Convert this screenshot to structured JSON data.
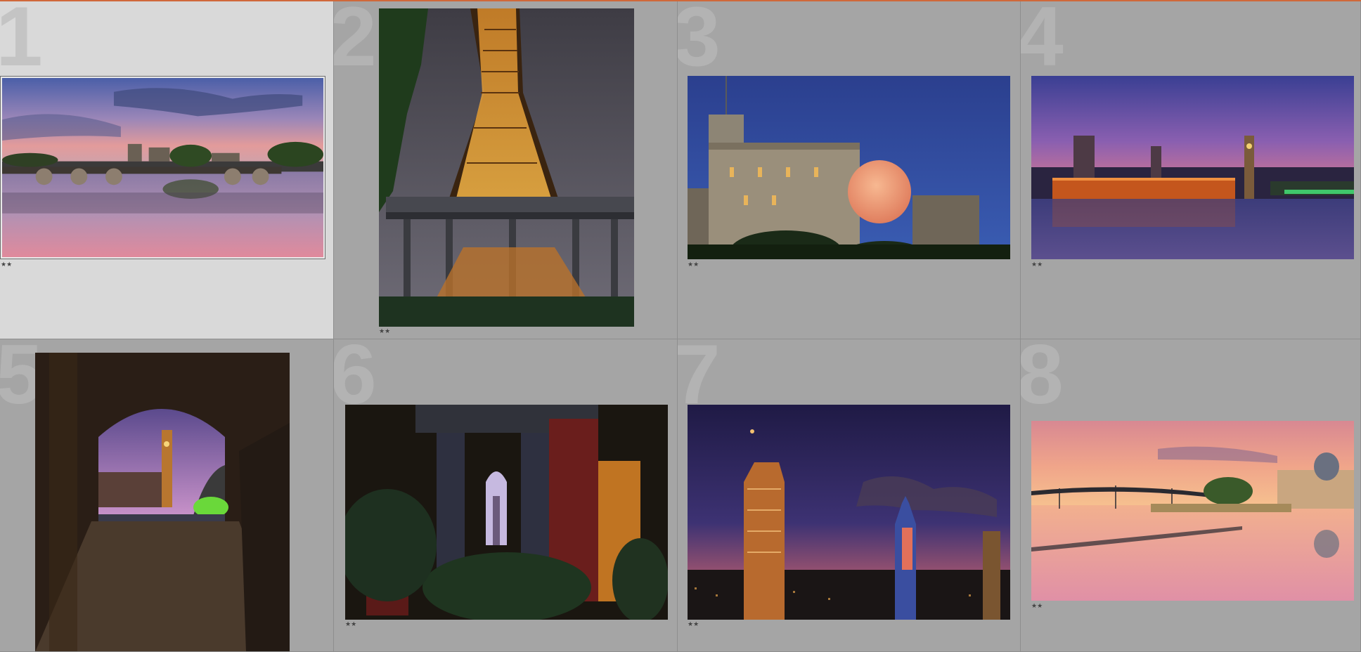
{
  "grid": {
    "cells": [
      {
        "index": "1",
        "rating": "★★",
        "subject": "river bridge at sunset",
        "selected": true
      },
      {
        "index": "2",
        "rating": "★★",
        "subject": "eiffel tower at night"
      },
      {
        "index": "3",
        "rating": "★★",
        "subject": "castle tower with full moon"
      },
      {
        "index": "4",
        "rating": "★★",
        "subject": "westminster palace at dusk"
      },
      {
        "index": "5",
        "rating": "",
        "subject": "big ben through archway"
      },
      {
        "index": "6",
        "rating": "★★",
        "subject": "empire state through bridge"
      },
      {
        "index": "7",
        "rating": "★★",
        "subject": "city skyline at night"
      },
      {
        "index": "8",
        "rating": "★★",
        "subject": "paris footbridge reflection"
      }
    ]
  },
  "colors": {
    "background": "#a5a5a5",
    "selected_cell": "#d9d9d9",
    "accent_strip": "#d0683a"
  }
}
